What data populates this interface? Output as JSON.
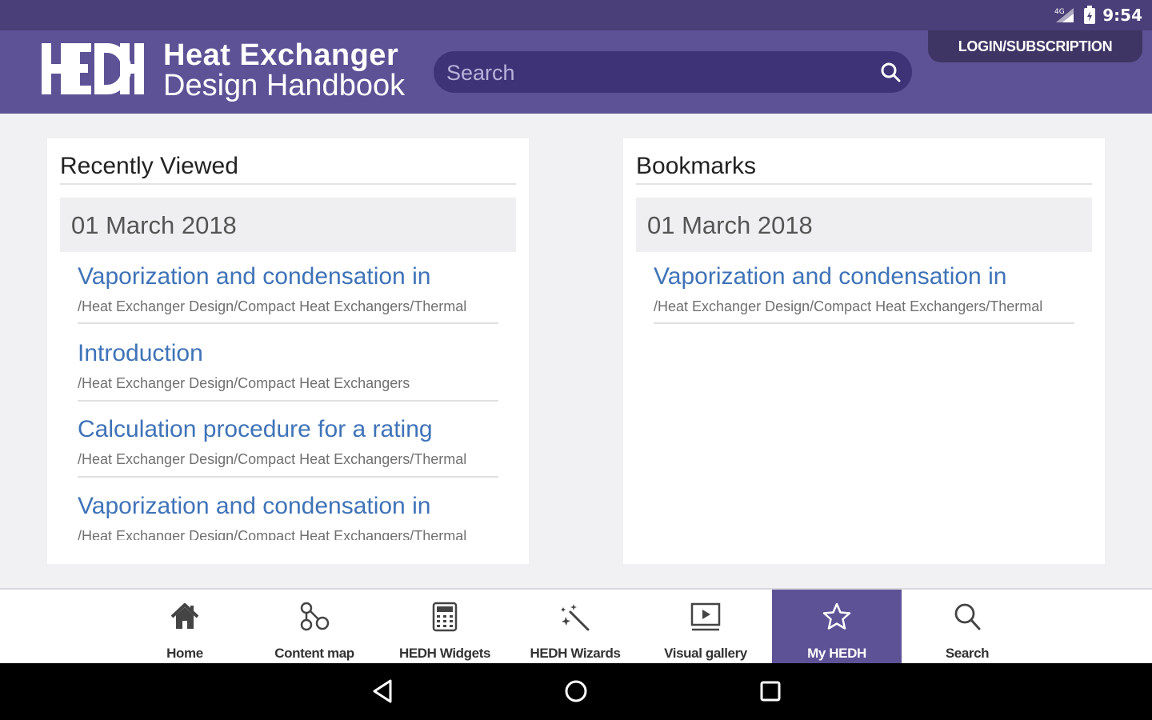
{
  "status_bar": {
    "time": "9:54"
  },
  "header": {
    "brand_line1": "Heat Exchanger",
    "brand_line2": "Design Handbook",
    "search_placeholder": "Search",
    "login_label": "LOGIN/SUBSCRIPTION"
  },
  "recently_viewed": {
    "title": "Recently Viewed",
    "date": "01 March 2018",
    "items": [
      {
        "title": "Vaporization and condensation in",
        "path": "/Heat Exchanger Design/Compact Heat Exchangers/Thermal"
      },
      {
        "title": "Introduction",
        "path": "/Heat Exchanger Design/Compact Heat Exchangers"
      },
      {
        "title": "Calculation procedure for a rating",
        "path": "/Heat Exchanger Design/Compact Heat Exchangers/Thermal"
      },
      {
        "title": "Vaporization and condensation in",
        "path": "/Heat Exchanger Design/Compact Heat Exchangers/Thermal"
      }
    ]
  },
  "bookmarks": {
    "title": "Bookmarks",
    "date": "01 March 2018",
    "items": [
      {
        "title": "Vaporization and condensation in",
        "path": "/Heat Exchanger Design/Compact Heat Exchangers/Thermal"
      }
    ]
  },
  "bottom_nav": {
    "items": [
      {
        "label": "Home",
        "icon": "home-icon"
      },
      {
        "label": "Content map",
        "icon": "content-map-icon"
      },
      {
        "label": "HEDH Widgets",
        "icon": "calculator-icon"
      },
      {
        "label": "HEDH Wizards",
        "icon": "magic-wand-icon"
      },
      {
        "label": "Visual gallery",
        "icon": "video-icon"
      },
      {
        "label": "My HEDH",
        "icon": "star-icon",
        "active": true
      },
      {
        "label": "Search",
        "icon": "search-icon"
      }
    ]
  },
  "colors": {
    "status_bar": "#4a3f78",
    "header": "#5e5296",
    "search_field": "#3e3377",
    "link": "#3f73b8",
    "active_tab": "#5e5296"
  }
}
